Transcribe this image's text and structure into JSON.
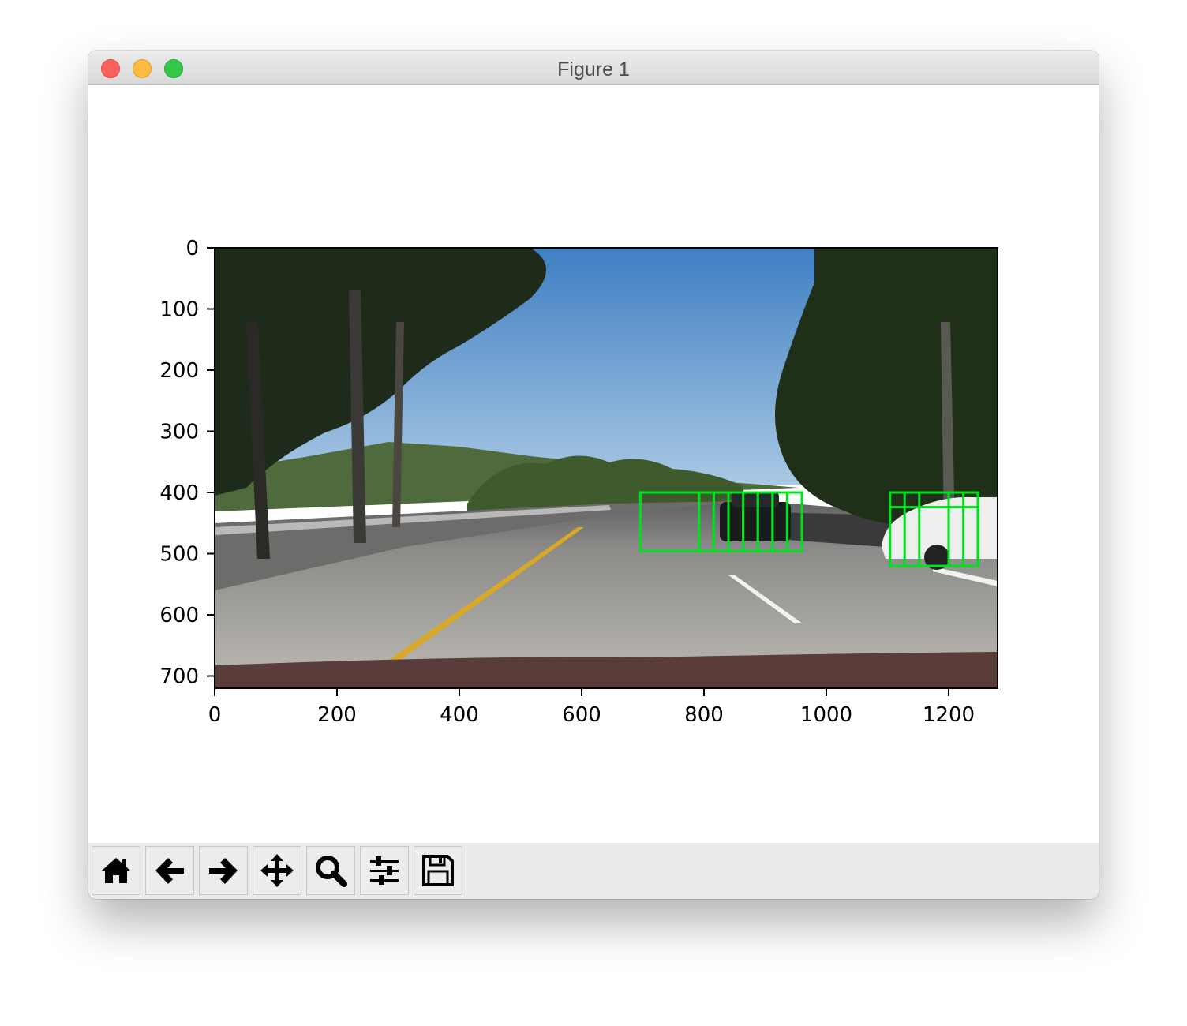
{
  "window": {
    "title": "Figure 1"
  },
  "toolbar": {
    "buttons": [
      {
        "name": "home-button",
        "icon": "home-icon"
      },
      {
        "name": "back-button",
        "icon": "arrow-left-icon"
      },
      {
        "name": "forward-button",
        "icon": "arrow-right-icon"
      },
      {
        "name": "pan-button",
        "icon": "move-icon"
      },
      {
        "name": "zoom-button",
        "icon": "magnifier-icon"
      },
      {
        "name": "configure-subplots-button",
        "icon": "sliders-icon"
      },
      {
        "name": "save-button",
        "icon": "floppy-disk-icon"
      }
    ]
  },
  "chart_data": {
    "type": "image",
    "image_description_colors": {
      "box_color": "#00e01e",
      "sky": "#4e86c4"
    },
    "x_ticks": [
      0,
      200,
      400,
      600,
      800,
      1000,
      1200
    ],
    "y_ticks": [
      0,
      100,
      200,
      300,
      400,
      500,
      600,
      700
    ],
    "xlim": [
      0,
      1280
    ],
    "ylim": [
      720,
      0
    ],
    "grid": false,
    "detection_boxes": [
      {
        "x0": 696,
        "y0": 400,
        "x1": 792,
        "y1": 496
      },
      {
        "x0": 792,
        "y0": 400,
        "x1": 816,
        "y1": 496
      },
      {
        "x0": 816,
        "y0": 400,
        "x1": 840,
        "y1": 496
      },
      {
        "x0": 840,
        "y0": 400,
        "x1": 864,
        "y1": 496
      },
      {
        "x0": 864,
        "y0": 400,
        "x1": 888,
        "y1": 496
      },
      {
        "x0": 888,
        "y0": 400,
        "x1": 912,
        "y1": 496
      },
      {
        "x0": 912,
        "y0": 400,
        "x1": 936,
        "y1": 496
      },
      {
        "x0": 936,
        "y0": 400,
        "x1": 960,
        "y1": 496
      },
      {
        "x0": 1104,
        "y0": 400,
        "x1": 1248,
        "y1": 520
      },
      {
        "x0": 1128,
        "y0": 400,
        "x1": 1248,
        "y1": 520
      },
      {
        "x0": 1152,
        "y0": 400,
        "x1": 1248,
        "y1": 520
      },
      {
        "x0": 1200,
        "y0": 400,
        "x1": 1248,
        "y1": 520
      },
      {
        "x0": 1224,
        "y0": 400,
        "x1": 1248,
        "y1": 520
      },
      {
        "x0": 1104,
        "y0": 424,
        "x1": 1248,
        "y1": 520
      }
    ]
  }
}
